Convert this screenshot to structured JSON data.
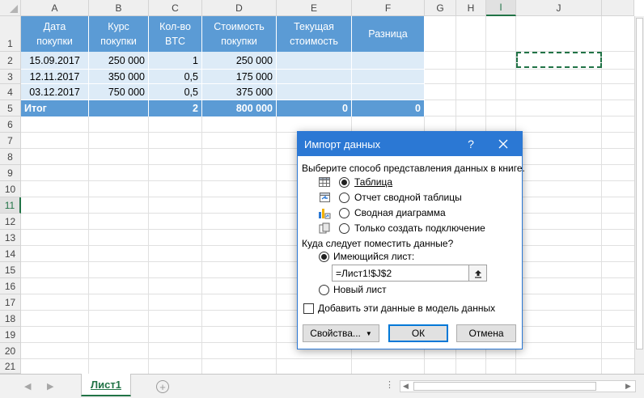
{
  "sheet": {
    "columns": [
      "A",
      "B",
      "C",
      "D",
      "E",
      "F",
      "G",
      "H",
      "I",
      "J"
    ],
    "rows": [
      "1",
      "2",
      "3",
      "4",
      "5",
      "6",
      "7",
      "8",
      "9",
      "10",
      "11",
      "12",
      "13",
      "14",
      "15",
      "16",
      "17",
      "18",
      "19",
      "20",
      "21"
    ],
    "selected_column": "I",
    "selected_row": "11",
    "table": {
      "headers": [
        "Дата\nпокупки",
        "Курс\nпокупки",
        "Кол-во\nBTC",
        "Стоимость\nпокупки",
        "Текущая\nстоимость",
        "Разница"
      ],
      "rows": [
        [
          "15.09.2017",
          "250 000",
          "1",
          "250 000",
          "",
          ""
        ],
        [
          "12.11.2017",
          "350 000",
          "0,5",
          "175 000",
          "",
          ""
        ],
        [
          "03.12.2017",
          "750 000",
          "0,5",
          "375 000",
          "",
          ""
        ]
      ],
      "total": [
        "Итог",
        "",
        "2",
        "800 000",
        "0",
        "0"
      ]
    },
    "colors": {
      "header_fill": "#5b9bd5",
      "band_fill": "#ddebf7",
      "selection_border": "#217346"
    }
  },
  "dialog": {
    "title": "Импорт данных",
    "help": "?",
    "prompt_view": "Выберите способ представления данных в книге.",
    "view_options": [
      {
        "label": "Таблица",
        "icon": "table-icon",
        "selected": true
      },
      {
        "label": "Отчет сводной таблицы",
        "icon": "pivot-table-icon",
        "selected": false
      },
      {
        "label": "Сводная диаграмма",
        "icon": "pivot-chart-icon",
        "selected": false
      },
      {
        "label": "Только создать подключение",
        "icon": "connection-icon",
        "selected": false
      }
    ],
    "prompt_location": "Куда следует поместить данные?",
    "location_options": [
      {
        "label": "Имеющийся лист:",
        "selected": true
      },
      {
        "label": "Новый лист",
        "selected": false
      }
    ],
    "reference_value": "=Лист1!$J$2",
    "model_checkbox": {
      "label": "Добавить эти данные в модель данных",
      "checked": false
    },
    "buttons": {
      "properties": "Свойства...",
      "ok": "ОК",
      "cancel": "Отмена"
    },
    "accent": "#2b78d4"
  },
  "tabs": {
    "sheets": [
      "Лист1"
    ],
    "active": "Лист1",
    "add_sheet": "+"
  }
}
